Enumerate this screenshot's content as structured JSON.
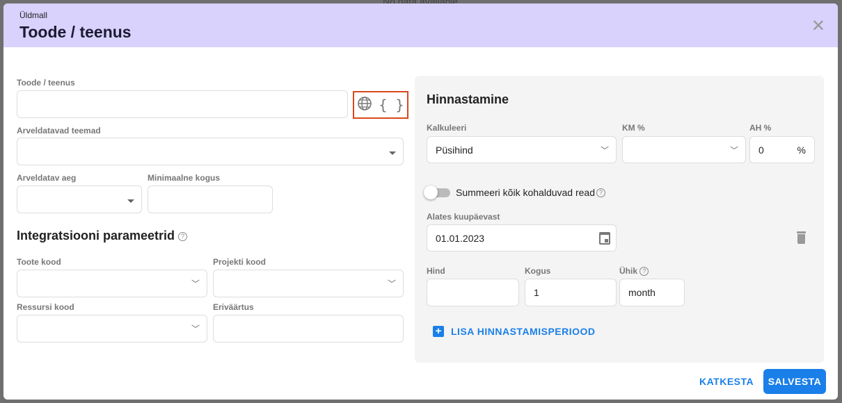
{
  "background": {
    "no_data": "No data available"
  },
  "header": {
    "subtitle": "Üldmall",
    "title": "Toode / teenus",
    "close_icon": "close-icon"
  },
  "left": {
    "product_label": "Toode / teenus",
    "product_value": "",
    "billable_topics_label": "Arveldatavad teemad",
    "billable_time_label": "Arveldatav aeg",
    "min_qty_label": "Minimaalne kogus",
    "integration_title": "Integratsiooni parameetrid",
    "product_code_label": "Toote kood",
    "project_code_label": "Projekti kood",
    "resource_code_label": "Ressursi kood",
    "custom_value_label": "Eriväärtus"
  },
  "pricing": {
    "title": "Hinnastamine",
    "calc_label": "Kalkuleeri",
    "calc_value": "Püsihind",
    "vat_label": "KM %",
    "vat_value": "",
    "discount_label": "AH %",
    "discount_value": "0",
    "percent": "%",
    "sum_toggle_label": "Summeeri kõik kohalduvad read",
    "sum_toggle_on": false,
    "from_date_label": "Alates kuupäevast",
    "from_date_value": "01.01.2023",
    "price_label": "Hind",
    "price_value": "",
    "qty_label": "Kogus",
    "qty_value": "1",
    "unit_label": "Ühik",
    "unit_value": "month",
    "add_period": "LISA HINNASTAMISPERIOOD"
  },
  "footer": {
    "cancel": "KATKESTA",
    "save": "SALVESTA"
  },
  "colors": {
    "accent": "#1a7fe8",
    "header": "#d8d2fc",
    "highlight": "#d9481c"
  }
}
